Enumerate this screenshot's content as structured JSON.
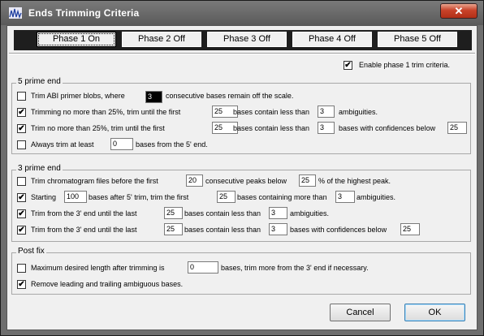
{
  "window": {
    "title": "Ends Trimming Criteria",
    "close_label": "✕"
  },
  "tabs": [
    {
      "label": "Phase 1 On"
    },
    {
      "label": "Phase 2 Off"
    },
    {
      "label": "Phase 3 Off"
    },
    {
      "label": "Phase 4 Off"
    },
    {
      "label": "Phase 5 Off"
    }
  ],
  "enable": {
    "label": "Enable phase 1 trim criteria.",
    "checked": true
  },
  "five_prime": {
    "title": "5 prime end",
    "row1": {
      "checked": false,
      "a": "Trim ABI primer blobs, where",
      "v1": "3",
      "b": "consecutive bases remain off the scale."
    },
    "row2": {
      "checked": true,
      "a": "Trimming no more than 25%, trim until the first",
      "v1": "25",
      "b": "bases contain less than",
      "v2": "3",
      "c": "ambiguities."
    },
    "row3": {
      "checked": true,
      "a": "Trim no more than 25%, trim until the first",
      "v1": "25",
      "b": "bases contain less than",
      "v2": "3",
      "c": "bases with confidences below",
      "v3": "25"
    },
    "row4": {
      "checked": false,
      "a": "Always trim at least",
      "v1": "0",
      "b": "bases from the 5' end."
    }
  },
  "three_prime": {
    "title": "3 prime end",
    "row1": {
      "checked": false,
      "a": "Trim chromatogram files before the first",
      "v1": "20",
      "b": "consecutive peaks below",
      "v2": "25",
      "c": "% of the highest peak."
    },
    "row2": {
      "checked": true,
      "a": "Starting",
      "v1": "100",
      "b": "bases after 5' trim, trim the first",
      "v2": "25",
      "c": "bases containing more than",
      "v3": "3",
      "d": "ambiguities."
    },
    "row3": {
      "checked": true,
      "a": "Trim from the 3' end until the last",
      "v1": "25",
      "b": "bases contain less than",
      "v2": "3",
      "c": "ambiguities."
    },
    "row4": {
      "checked": true,
      "a": "Trim from the 3' end until the last",
      "v1": "25",
      "b": "bases contain less than",
      "v2": "3",
      "c": "bases with confidences below",
      "v3": "25"
    }
  },
  "post_fix": {
    "title": "Post fix",
    "row1": {
      "checked": false,
      "a": "Maximum desired length after trimming is",
      "v1": "0",
      "b": "bases, trim more from the 3' end if necessary."
    },
    "row2": {
      "checked": true,
      "a": "Remove leading and trailing ambiguous bases."
    }
  },
  "buttons": {
    "cancel": "Cancel",
    "ok": "OK"
  },
  "colors": {
    "titlebar": "#6e6e6e",
    "close": "#c8432a",
    "dialog_bg": "#f0f0f0",
    "tabbar": "#1e1e1e"
  }
}
